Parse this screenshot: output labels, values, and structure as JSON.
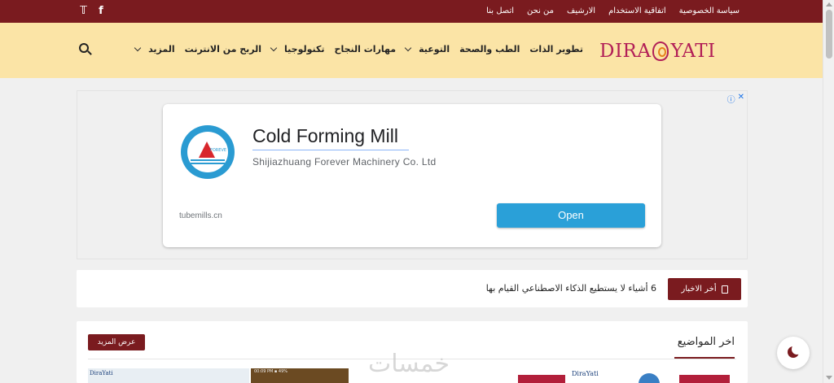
{
  "topbar": {
    "links": [
      "سياسة الخصوصية",
      "اتفاقية الاستخدام",
      "الارشيف",
      "من نحن",
      "اتصل بنا"
    ],
    "social": {
      "twitter": "𝕋",
      "facebook": "f"
    },
    "social_icons": [
      "twitter-icon",
      "facebook-icon"
    ]
  },
  "header": {
    "logo_left": "DIRA",
    "logo_right": "YATI",
    "nav": [
      {
        "label": "تطوير الذات",
        "dropdown": false
      },
      {
        "label": "الطب والصحة",
        "dropdown": false
      },
      {
        "label": "التوعية",
        "dropdown": true
      },
      {
        "label": "مهارات النجاح",
        "dropdown": false
      },
      {
        "label": "تكنولوجيا",
        "dropdown": true
      },
      {
        "label": "الربح من الانترنت",
        "dropdown": false
      },
      {
        "label": "المزيد",
        "dropdown": true
      }
    ],
    "search_icon": "search-icon"
  },
  "ad": {
    "adchoices": [
      "ⓘ",
      "✕"
    ],
    "title": "Cold Forming Mill",
    "company": "Shijiazhuang Forever Machinery Co. Ltd",
    "logo_text": "FOREVE",
    "domain": "tubemills.cn",
    "cta": "Open"
  },
  "ticker": {
    "label": "أخر الاخبار",
    "headline": "6 أشياء لا يستطيع الذكاء الاصطناعي القيام بها"
  },
  "latest": {
    "heading": "اخر المواضيع",
    "more": "عرض المزيد",
    "thumb_logo_1": "DiraYati",
    "thumb_logo_2": "DiraYati",
    "thumb_time": "00:09 PM ▪ 49%"
  },
  "watermark": "خمسات",
  "colors": {
    "primary": "#7a1b1f",
    "header_bg": "#fbe4a6",
    "logo": "#b21f57",
    "cta": "#2aa0d8"
  }
}
